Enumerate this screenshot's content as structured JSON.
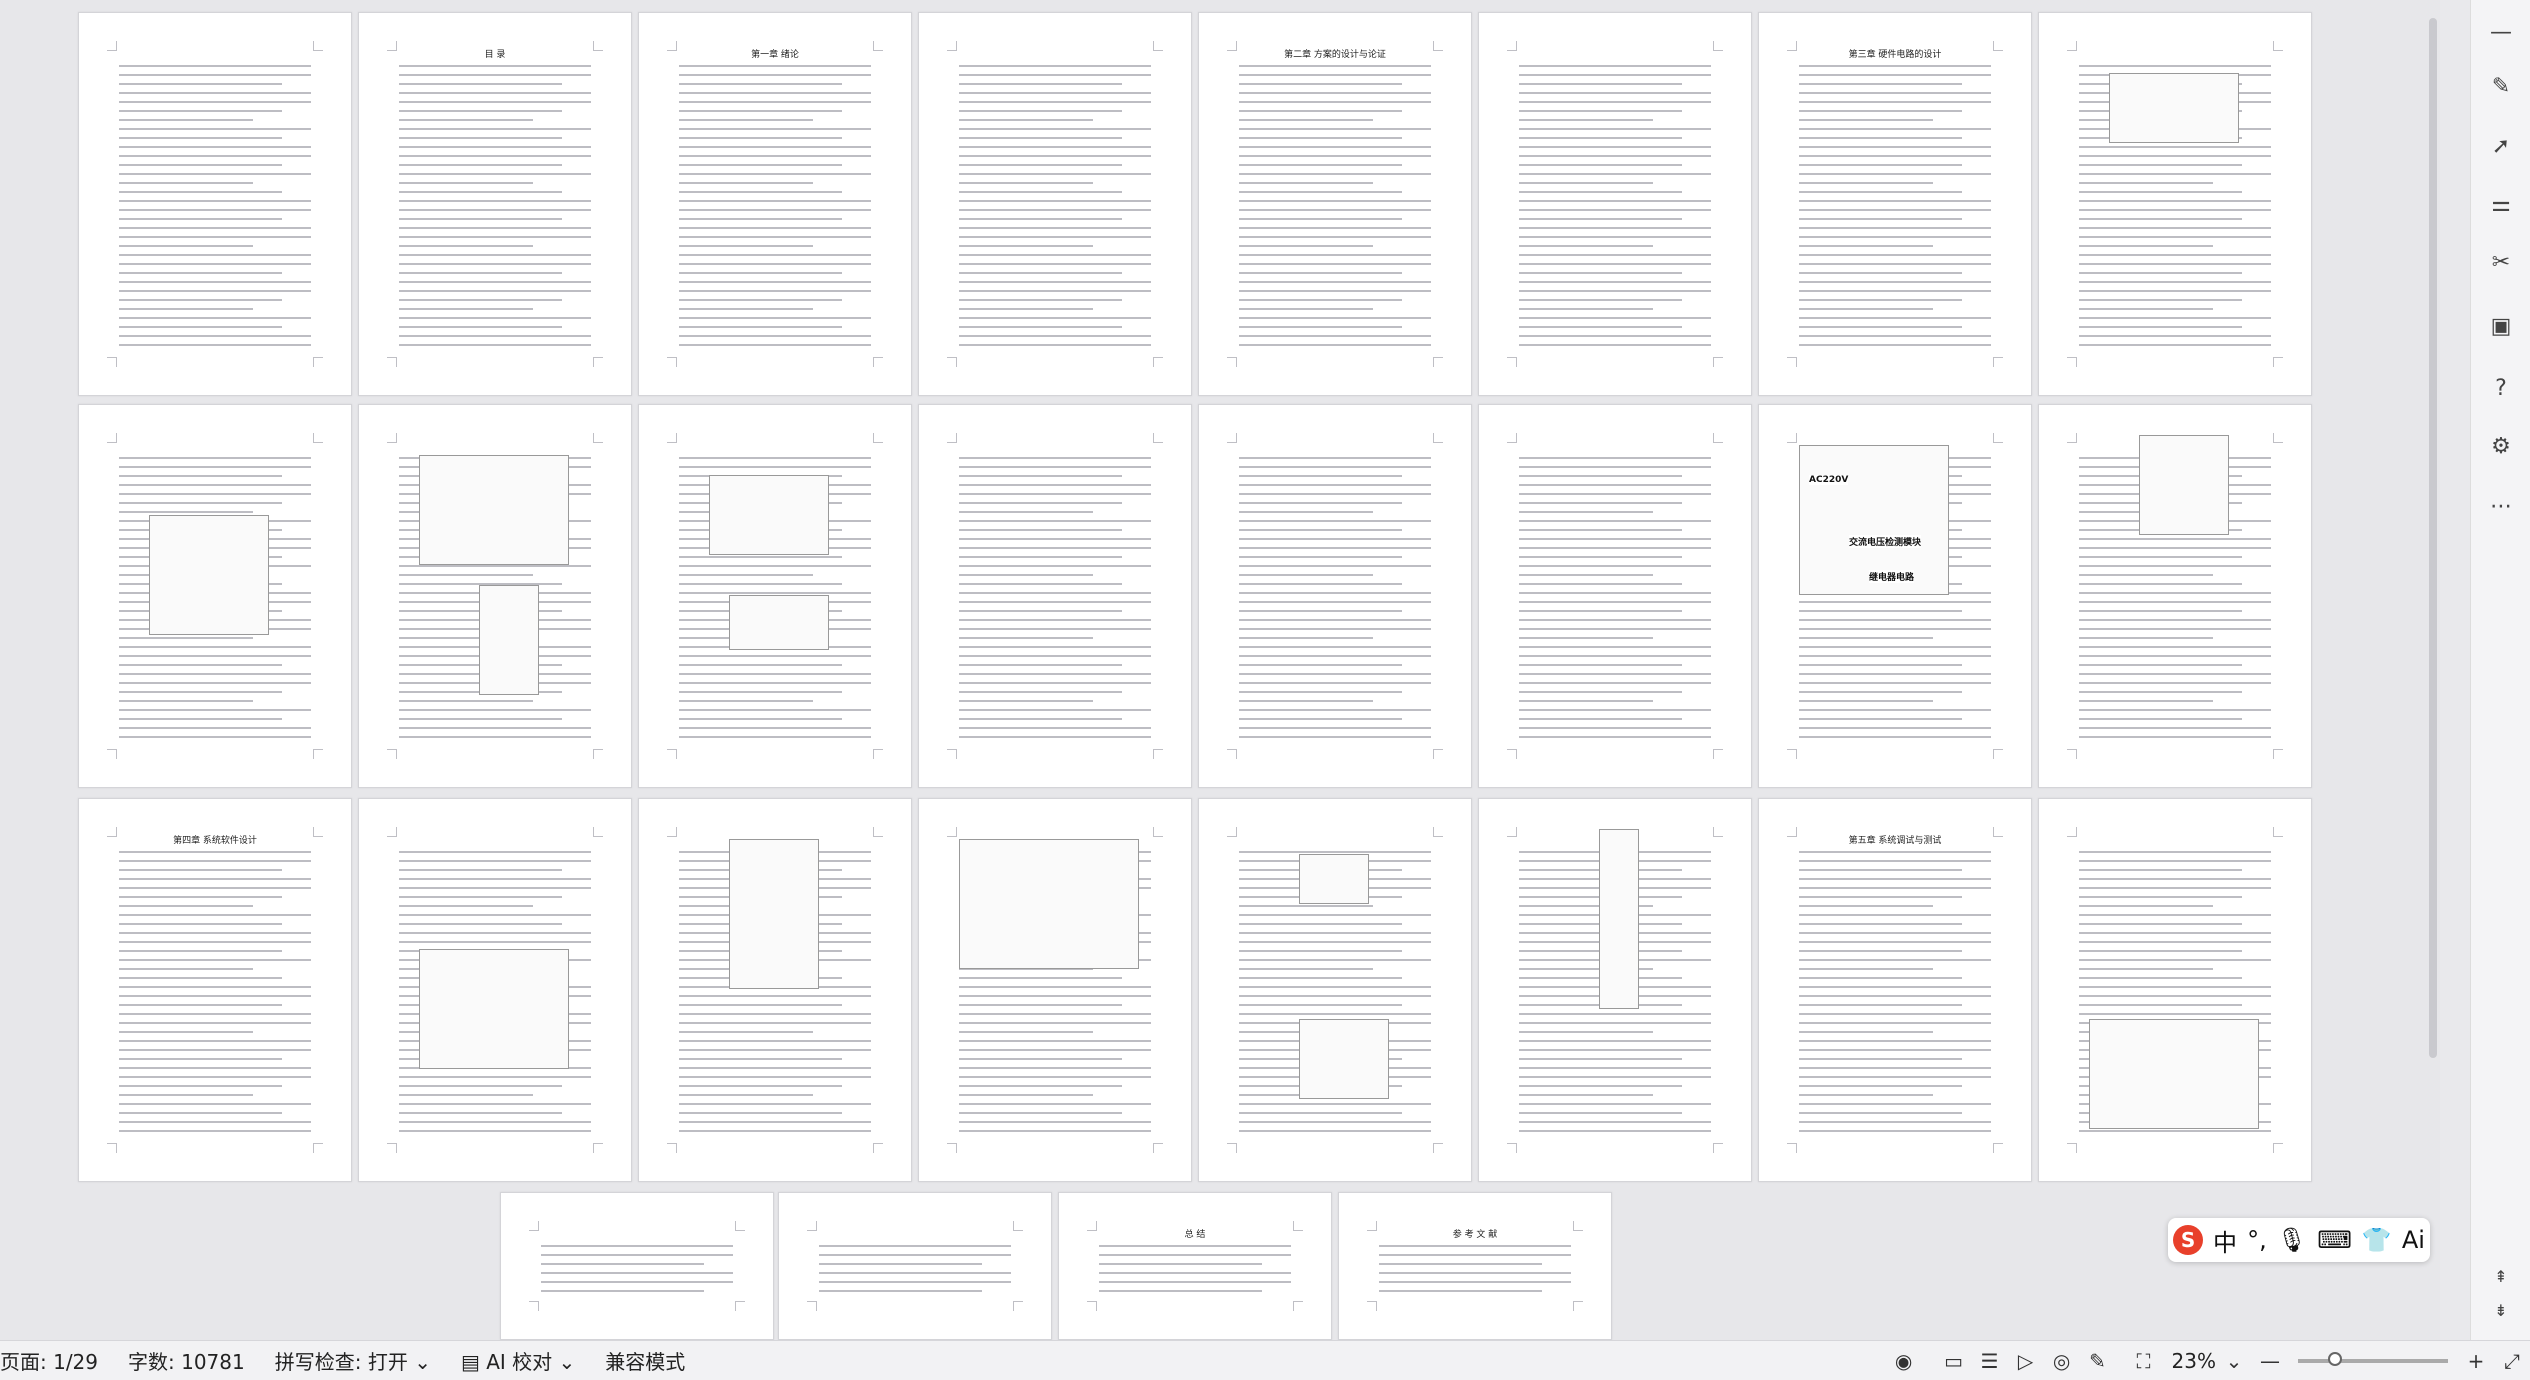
{
  "pages": [
    {
      "title": ""
    },
    {
      "title": "目 录"
    },
    {
      "title": "第一章 绪论"
    },
    {
      "title": ""
    },
    {
      "title": "第二章 方案的设计与论证"
    },
    {
      "title": ""
    },
    {
      "title": "第三章 硬件电路的设计"
    },
    {
      "title": ""
    },
    {
      "title": ""
    },
    {
      "title": ""
    },
    {
      "title": ""
    },
    {
      "title": ""
    },
    {
      "title": ""
    },
    {
      "title": ""
    },
    {
      "title": ""
    },
    {
      "title": ""
    },
    {
      "title": "第四章 系统软件设计"
    },
    {
      "title": ""
    },
    {
      "title": ""
    },
    {
      "title": ""
    },
    {
      "title": ""
    },
    {
      "title": ""
    },
    {
      "title": "第五章 系统调试与测试"
    },
    {
      "title": ""
    },
    {
      "title": ""
    },
    {
      "title": ""
    },
    {
      "title": "总 结"
    },
    {
      "title": "参 考 文 献"
    }
  ],
  "figure_labels": {
    "ac220v": "AC220V",
    "mains_detect": "交流电压检测模块",
    "relay_circuit": "继电器电路"
  },
  "statusbar": {
    "page": "页面: 1/29",
    "wordcount": "字数: 10781",
    "spellcheck": "拼写检查: 打开",
    "ai_proof": "AI 校对",
    "compat_mode": "兼容模式",
    "zoom": "23%"
  },
  "ime": {
    "lang": "中",
    "punct": "°,",
    "ai": "Ai"
  }
}
